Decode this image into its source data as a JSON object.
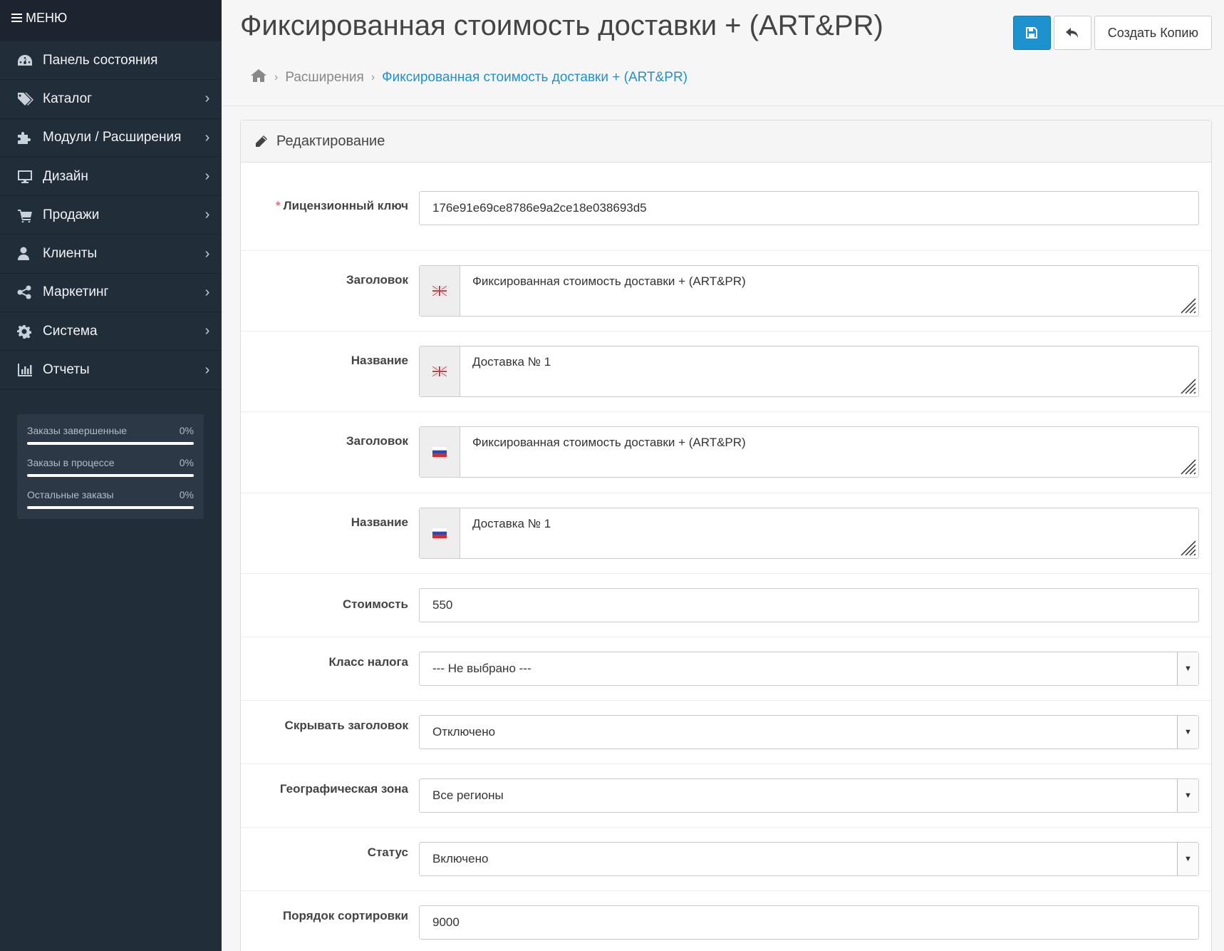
{
  "sidebar": {
    "menu_title": "МЕНЮ",
    "items": [
      {
        "label": "Панель состояния",
        "icon": "dashboard-icon",
        "has_submenu": false
      },
      {
        "label": "Каталог",
        "icon": "tags-icon",
        "has_submenu": true
      },
      {
        "label": "Модули / Расширения",
        "icon": "puzzle-icon",
        "has_submenu": true
      },
      {
        "label": "Дизайн",
        "icon": "desktop-icon",
        "has_submenu": true
      },
      {
        "label": "Продажи",
        "icon": "cart-icon",
        "has_submenu": true
      },
      {
        "label": "Клиенты",
        "icon": "user-icon",
        "has_submenu": true
      },
      {
        "label": "Маркетинг",
        "icon": "share-icon",
        "has_submenu": true
      },
      {
        "label": "Система",
        "icon": "gear-icon",
        "has_submenu": true
      },
      {
        "label": "Отчеты",
        "icon": "bar-chart-icon",
        "has_submenu": true
      }
    ],
    "stats": [
      {
        "label": "Заказы завершенные",
        "value": "0%"
      },
      {
        "label": "Заказы в процессе",
        "value": "0%"
      },
      {
        "label": "Остальные заказы",
        "value": "0%"
      }
    ]
  },
  "header": {
    "title": "Фиксированная стоимость доставки + (ART&PR)",
    "breadcrumb": [
      "Расширения",
      "Фиксированная стоимость доставки + (ART&PR)"
    ],
    "copy_button": "Создать Копию"
  },
  "panel": {
    "heading": "Редактирование",
    "license": {
      "required_mark": "*",
      "label": "Лицензионный ключ",
      "value": "176e91e69ce8786e9a2ce18e038693d5"
    },
    "title_en": {
      "label": "Заголовок",
      "value": "Фиксированная стоимость доставки + (ART&PR)",
      "flag": "uk-flag-icon"
    },
    "name_en": {
      "label": "Название",
      "value": "Доставка № 1",
      "flag": "uk-flag-icon"
    },
    "title_ru": {
      "label": "Заголовок",
      "value": "Фиксированная стоимость доставки + (ART&PR)",
      "flag": "ru-flag-icon"
    },
    "name_ru": {
      "label": "Название",
      "value": "Доставка № 1",
      "flag": "ru-flag-icon"
    },
    "cost": {
      "label": "Стоимость",
      "value": "550"
    },
    "tax_class": {
      "label": "Класс налога",
      "value": "--- Не выбрано ---"
    },
    "hide_title": {
      "label": "Скрывать заголовок",
      "value": "Отключено"
    },
    "geo_zone": {
      "label": "Географическая зона",
      "value": "Все регионы"
    },
    "status": {
      "label": "Статус",
      "value": "Включено"
    },
    "sort_order": {
      "label": "Порядок сортировки",
      "value": "9000"
    }
  },
  "colors": {
    "sidebar_bg": "#222d3a",
    "primary": "#1e91cf",
    "required": "#f56b6b"
  }
}
